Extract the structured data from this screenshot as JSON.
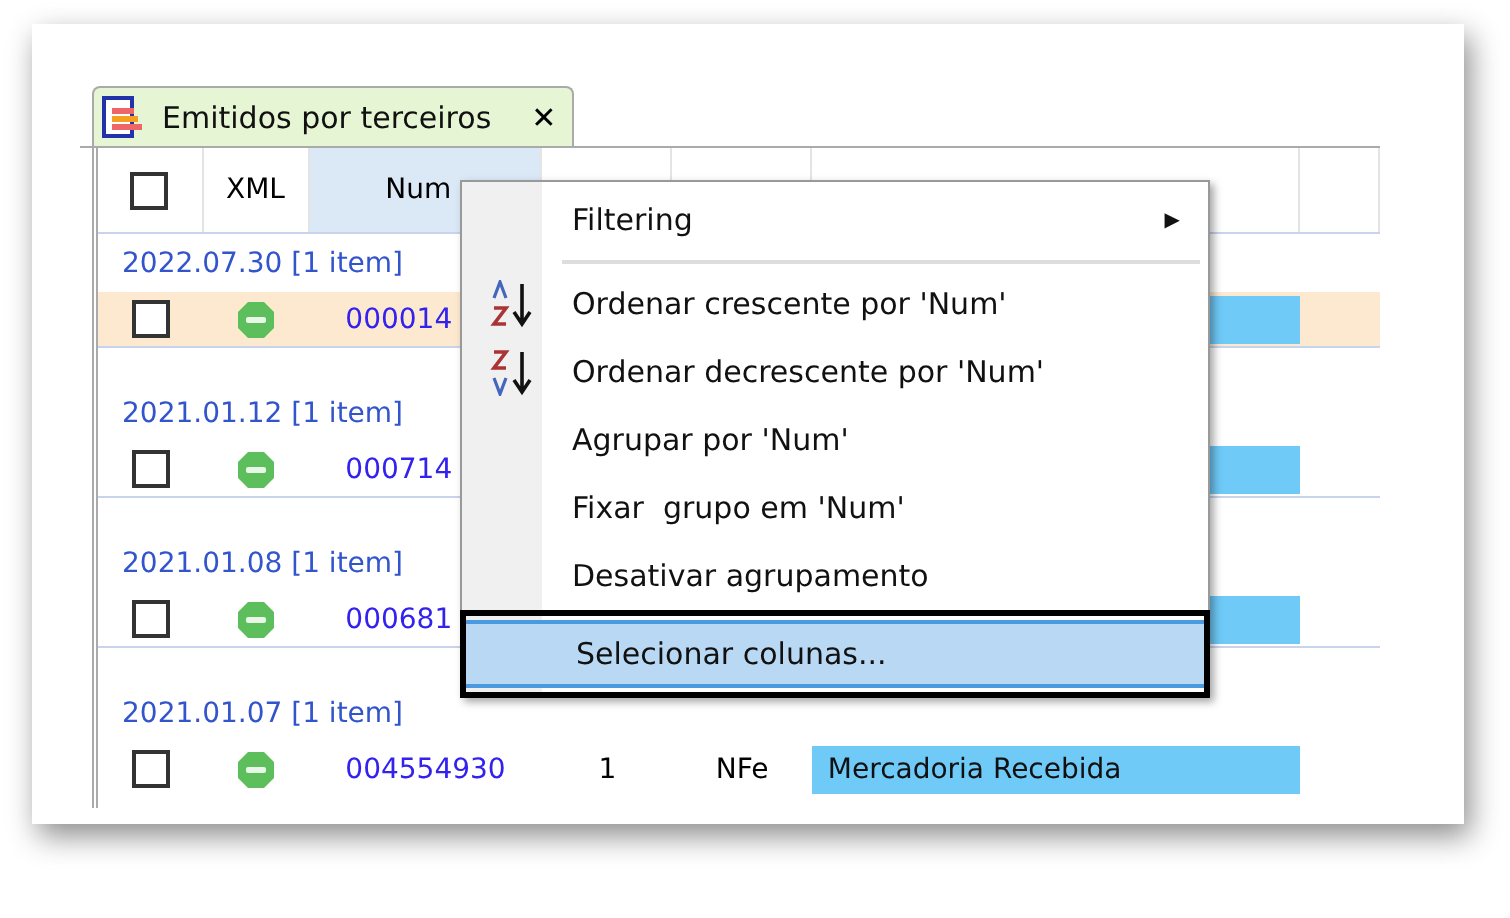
{
  "tab": {
    "title": "Emitidos por terceiros",
    "close": "✕"
  },
  "columns": [
    {
      "kind": "checkbox",
      "checked": false
    },
    {
      "kind": "text",
      "label": "XML"
    },
    {
      "kind": "text",
      "label": "Num",
      "selected": true
    }
  ],
  "groups": [
    {
      "label": "2022.07.30 [1 item]",
      "rows": [
        {
          "checked": false,
          "selected": true,
          "num": "000014"
        }
      ]
    },
    {
      "label": "2021.01.12 [1 item]",
      "rows": [
        {
          "checked": false,
          "selected": false,
          "num": "000714"
        }
      ]
    },
    {
      "label": "2021.01.08 [1 item]",
      "rows": [
        {
          "checked": false,
          "selected": false,
          "num": "000681"
        }
      ]
    },
    {
      "label": "2021.01.07 [1 item]",
      "rows": [
        {
          "checked": false,
          "selected": false,
          "num": "004554930",
          "serie": "1",
          "tipo": "NFe",
          "status": "Mercadoria Recebida"
        }
      ]
    }
  ],
  "menu": [
    {
      "kind": "submenu",
      "label": "Filtering",
      "arrow": "▶"
    },
    {
      "kind": "separator"
    },
    {
      "kind": "sort-asc",
      "label": "Ordenar crescente por 'Num'"
    },
    {
      "kind": "sort-desc",
      "label": "Ordenar decrescente por 'Num'"
    },
    {
      "kind": "item",
      "label": "Agrupar por 'Num'"
    },
    {
      "kind": "item",
      "label": "Fixar  grupo em 'Num'"
    },
    {
      "kind": "item",
      "label": "Desativar agrupamento"
    },
    {
      "kind": "highlighted",
      "label": "Selecionar colunas..."
    }
  ]
}
